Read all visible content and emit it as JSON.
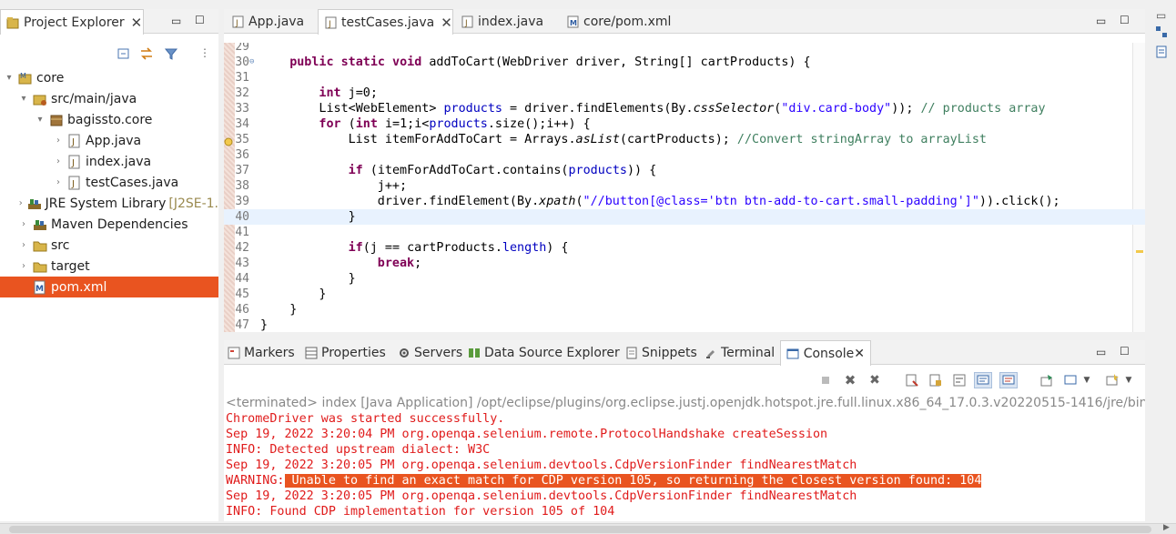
{
  "explorer": {
    "title": "Project Explorer",
    "items": [
      {
        "label": "core",
        "decor": ""
      },
      {
        "label": "src/main/java",
        "decor": ""
      },
      {
        "label": "bagissto.core",
        "decor": ""
      },
      {
        "label": "App.java",
        "decor": ""
      },
      {
        "label": "index.java",
        "decor": ""
      },
      {
        "label": "testCases.java",
        "decor": ""
      },
      {
        "label": "JRE System Library",
        "decor": "[J2SE-1."
      },
      {
        "label": "Maven Dependencies",
        "decor": ""
      },
      {
        "label": "src",
        "decor": ""
      },
      {
        "label": "target",
        "decor": ""
      },
      {
        "label": "pom.xml",
        "decor": ""
      }
    ]
  },
  "editor": {
    "tabs": [
      {
        "label": "App.java"
      },
      {
        "label": "testCases.java"
      },
      {
        "label": "index.java"
      },
      {
        "label": "core/pom.xml"
      }
    ],
    "lines": [
      {
        "num": "29",
        "text": ""
      },
      {
        "num": "30",
        "text": ""
      },
      {
        "num": "31",
        "text": ""
      },
      {
        "num": "32",
        "text": ""
      },
      {
        "num": "33",
        "text": ""
      },
      {
        "num": "34",
        "text": ""
      },
      {
        "num": "35",
        "text": ""
      },
      {
        "num": "36",
        "text": ""
      },
      {
        "num": "37",
        "text": ""
      },
      {
        "num": "38",
        "text": ""
      },
      {
        "num": "39",
        "text": ""
      },
      {
        "num": "40",
        "text": ""
      },
      {
        "num": "41",
        "text": ""
      },
      {
        "num": "42",
        "text": ""
      },
      {
        "num": "43",
        "text": ""
      },
      {
        "num": "44",
        "text": ""
      },
      {
        "num": "45",
        "text": ""
      },
      {
        "num": "46",
        "text": ""
      },
      {
        "num": "47",
        "text": ""
      }
    ],
    "code": {
      "l30": {
        "kw": "public static void",
        "rest": " addToCart(WebDriver driver, String[] cartProducts) {"
      },
      "l32": {
        "kw": "int",
        "rest": " j=0;"
      },
      "l33": {
        "a": "List<WebElement> ",
        "fld": "products",
        "b": " = driver.findElements(By.",
        "itl": "cssSelector",
        "c": "(",
        "str": "\"div.card-body\"",
        "d": ")); ",
        "cmt": "// products array"
      },
      "l34": {
        "kw": "for",
        "a": " (",
        "kw2": "int",
        "b": " i=1;i<",
        "fld": "products",
        "c": ".size();i++) {"
      },
      "l35": {
        "a": "List itemForAddToCart = Arrays.",
        "itl": "asList",
        "b": "(cartProducts); ",
        "cmt": "//Convert stringArray to arrayList"
      },
      "l37": {
        "kw": "if",
        "a": " (itemForAddToCart.contains(",
        "fld": "products",
        "b": ")) {"
      },
      "l38": {
        "a": "j++;"
      },
      "l39": {
        "a": "driver.findElement(By.",
        "itl": "xpath",
        "b": "(",
        "str": "\"//button[@class='btn btn-add-to-cart.small-padding']\"",
        "c": ")).click();"
      },
      "l40": {
        "a": "}"
      },
      "l42": {
        "kw": "if",
        "a": "(j == cartProducts.",
        "fld": "length",
        "b": ") {"
      },
      "l43": {
        "kw": "break",
        "a": ";"
      },
      "l44": {
        "a": "}"
      },
      "l45": {
        "a": "}"
      },
      "l46": {
        "a": "}"
      },
      "l47": {
        "a": "}"
      }
    }
  },
  "views": {
    "tabs": [
      {
        "label": "Markers"
      },
      {
        "label": "Properties"
      },
      {
        "label": "Servers"
      },
      {
        "label": "Data Source Explorer"
      },
      {
        "label": "Snippets"
      },
      {
        "label": "Terminal"
      },
      {
        "label": "Console"
      }
    ]
  },
  "console": {
    "terminated": "<terminated> index [Java Application] /opt/eclipse/plugins/org.eclipse.justj.openjdk.hotspot.jre.full.linux.x86_64_17.0.3.v20220515-1416/jre/bin/java  (1",
    "lines": [
      "ChromeDriver was started successfully.",
      "Sep 19, 2022 3:20:04 PM org.openqa.selenium.remote.ProtocolHandshake createSession",
      "INFO: Detected upstream dialect: W3C",
      "Sep 19, 2022 3:20:05 PM org.openqa.selenium.devtools.CdpVersionFinder findNearestMatch",
      "",
      "Sep 19, 2022 3:20:05 PM org.openqa.selenium.devtools.CdpVersionFinder findNearestMatch",
      "INFO: Found CDP implementation for version 105 of 104"
    ],
    "warning_prefix": "WARNING:",
    "warning_highlight": " Unable to find an exact match for CDP version 105, so returning the closest version found: 104"
  },
  "colors": {
    "selection": "#e95420",
    "keyword": "#7f0055",
    "string": "#2a00ff",
    "comment": "#3f7f5f",
    "console_error": "#e01b1b"
  }
}
